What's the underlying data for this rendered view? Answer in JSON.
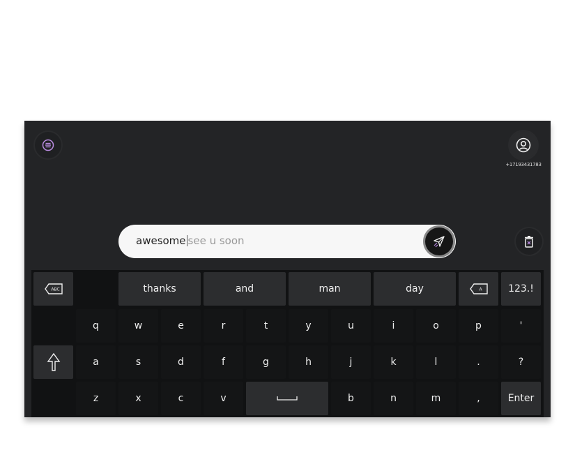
{
  "header": {
    "phone_number": "+17193431783"
  },
  "input": {
    "typed_text": "awesome",
    "suggestion_text": "see u soon"
  },
  "suggestions": [
    "thanks",
    "and",
    "man",
    "day"
  ],
  "keyboard": {
    "mode_key": "123.!",
    "enter_label": "Enter",
    "row1": [
      "q",
      "w",
      "e",
      "r",
      "t",
      "y",
      "u",
      "i",
      "o",
      "p",
      "'"
    ],
    "row2": [
      "a",
      "s",
      "d",
      "f",
      "g",
      "h",
      "j",
      "k",
      "l",
      ".",
      "?"
    ],
    "row3_left": [
      "z",
      "x",
      "c",
      "v"
    ],
    "row3_right": [
      "b",
      "n",
      "m",
      ","
    ]
  },
  "colors": {
    "accent": "#b98be0",
    "background": "#232426",
    "keyboard_bg": "#111213",
    "key_bg": "#2c2d2f"
  },
  "icons": [
    "menu-icon",
    "profile-icon",
    "send-icon",
    "trash-icon",
    "backspace-word-icon",
    "backspace-icon",
    "shift-icon",
    "space-icon"
  ]
}
